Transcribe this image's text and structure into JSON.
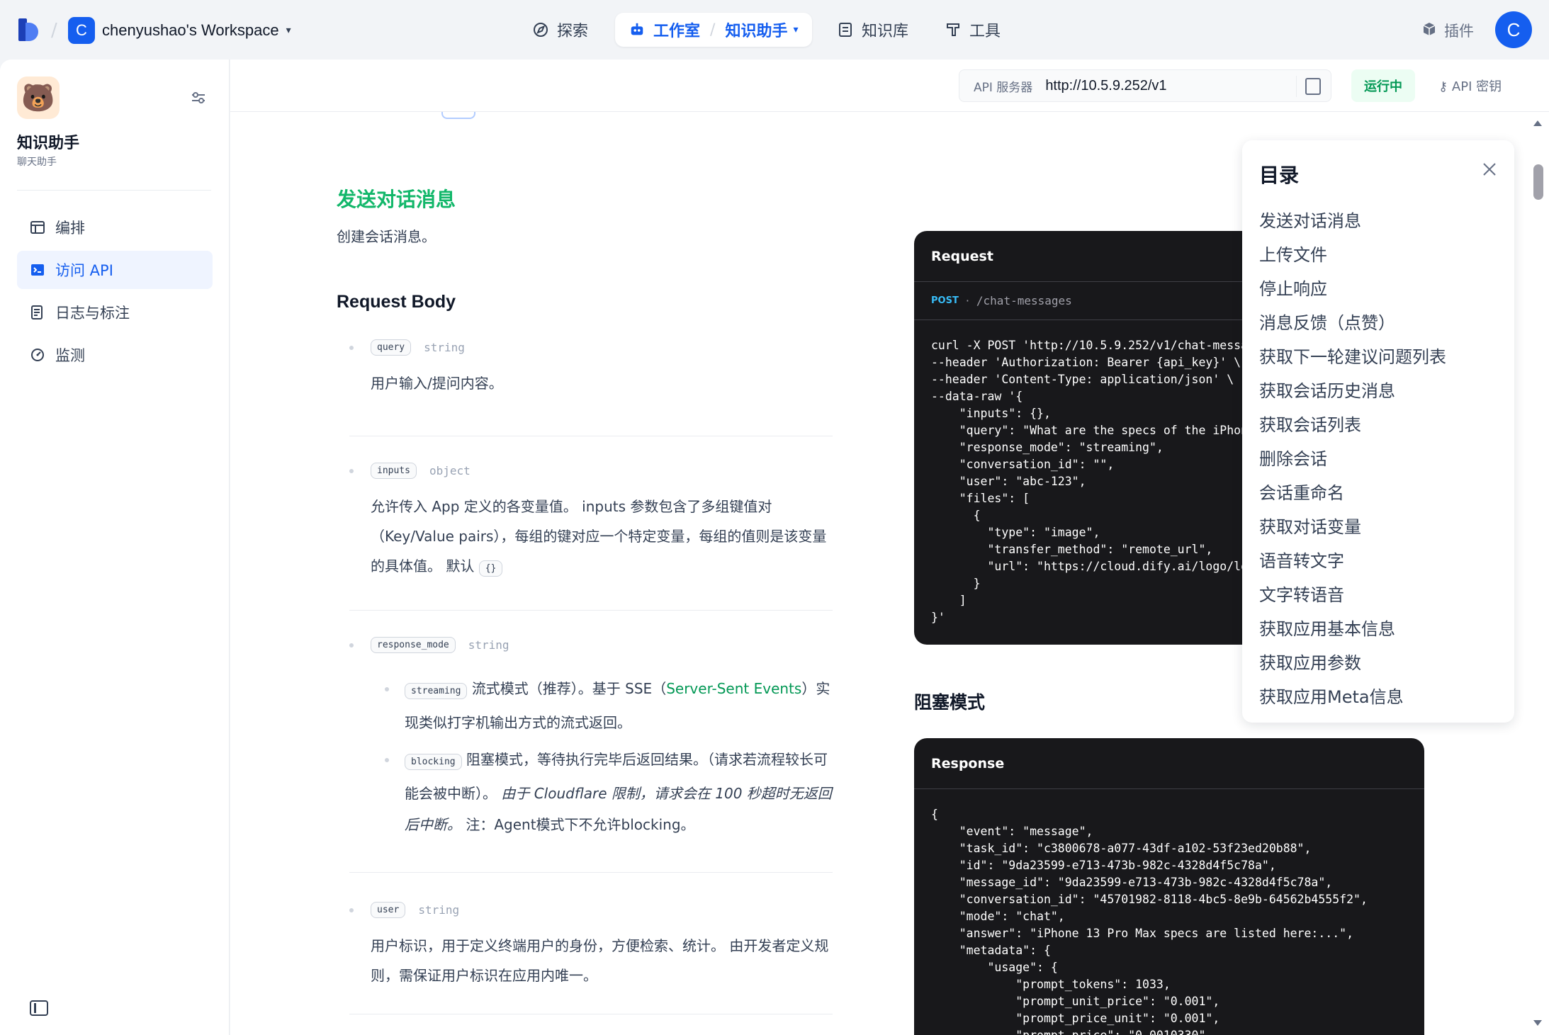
{
  "topbar": {
    "workspace_initial": "C",
    "workspace_name": "chenyushao's Workspace",
    "nav": {
      "explore": "探索",
      "studio": "工作室",
      "current_app": "知识助手",
      "knowledge": "知识库",
      "tools": "工具"
    },
    "plugins": "插件",
    "avatar_initial": "C"
  },
  "sidebar": {
    "app_icon": "🐻",
    "app_name": "知识助手",
    "app_type": "聊天助手",
    "items": [
      {
        "label": "编排",
        "icon": "layout-icon"
      },
      {
        "label": "访问 API",
        "icon": "terminal-icon"
      },
      {
        "label": "日志与标注",
        "icon": "log-icon"
      },
      {
        "label": "监测",
        "icon": "gauge-icon"
      }
    ]
  },
  "apibar": {
    "server_label": "API 服务器",
    "server_url": "http://10.5.9.252/v1",
    "status": "运行中",
    "api_key": "API 密钥"
  },
  "doc": {
    "section_title": "发送对话消息",
    "section_desc": "创建会话消息。",
    "request_body_title": "Request Body",
    "params": [
      {
        "name": "query",
        "type": "string",
        "desc": "用户输入/提问内容。"
      },
      {
        "name": "inputs",
        "type": "object",
        "desc": "允许传入 App 定义的各变量值。 inputs 参数包含了多组键值对（Key/Value pairs），每组的键对应一个特定变量，每组的值则是该变量的具体值。 默认",
        "default": "{}"
      },
      {
        "name": "response_mode",
        "type": "string",
        "streaming": {
          "pill": "streaming",
          "text1": "流式模式（推荐）。基于 SSE（",
          "link": "Server-Sent Events",
          "text2": "）实现类似打字机输出方式的流式返回。"
        },
        "blocking": {
          "pill": "blocking",
          "text1": "阻塞模式，等待执行完毕后返回结果。（请求若流程较长可能会被中断）。",
          "italic": "由于 Cloudflare 限制，请求会在 100 秒超时无返回后中断。",
          "text2": "注：Agent模式下不允许blocking。"
        }
      },
      {
        "name": "user",
        "type": "string",
        "desc": "用户标识，用于定义终端用户的身份，方便检索、统计。 由开发者定义规则，需保证用户标识在应用内唯一。"
      }
    ],
    "request_box": {
      "title": "Request",
      "method": "POST",
      "path": "/chat-messages",
      "code": "curl -X POST 'http://10.5.9.252/v1/chat-messages' \\\n--header 'Authorization: Bearer {api_key}' \\\n--header 'Content-Type: application/json' \\\n--data-raw '{\n    \"inputs\": {},\n    \"query\": \"What are the specs of the iPhone 13 Pro Max?\",\n    \"response_mode\": \"streaming\",\n    \"conversation_id\": \"\",\n    \"user\": \"abc-123\",\n    \"files\": [\n      {\n        \"type\": \"image\",\n        \"transfer_method\": \"remote_url\",\n        \"url\": \"https://cloud.dify.ai/logo/logo-site.png\"\n      }\n    ]\n}'"
    },
    "blocking_title": "阻塞模式",
    "response_box": {
      "title": "Response",
      "code": "{\n    \"event\": \"message\",\n    \"task_id\": \"c3800678-a077-43df-a102-53f23ed20b88\",\n    \"id\": \"9da23599-e713-473b-982c-4328d4f5c78a\",\n    \"message_id\": \"9da23599-e713-473b-982c-4328d4f5c78a\",\n    \"conversation_id\": \"45701982-8118-4bc5-8e9b-64562b4555f2\",\n    \"mode\": \"chat\",\n    \"answer\": \"iPhone 13 Pro Max specs are listed here:...\",\n    \"metadata\": {\n        \"usage\": {\n            \"prompt_tokens\": 1033,\n            \"prompt_unit_price\": \"0.001\",\n            \"prompt_price_unit\": \"0.001\",\n            \"prompt_price\": \"0.0010330\","
    }
  },
  "toc": {
    "title": "目录",
    "items": [
      "发送对话消息",
      "上传文件",
      "停止响应",
      "消息反馈（点赞）",
      "获取下一轮建议问题列表",
      "获取会话历史消息",
      "获取会话列表",
      "删除会话",
      "会话重命名",
      "获取对话变量",
      "语音转文字",
      "文字转语音",
      "获取应用基本信息",
      "获取应用参数",
      "获取应用Meta信息"
    ]
  },
  "colors": {
    "accent": "#155eef",
    "section_green": "#12b76a",
    "code_bg": "#18181b"
  }
}
